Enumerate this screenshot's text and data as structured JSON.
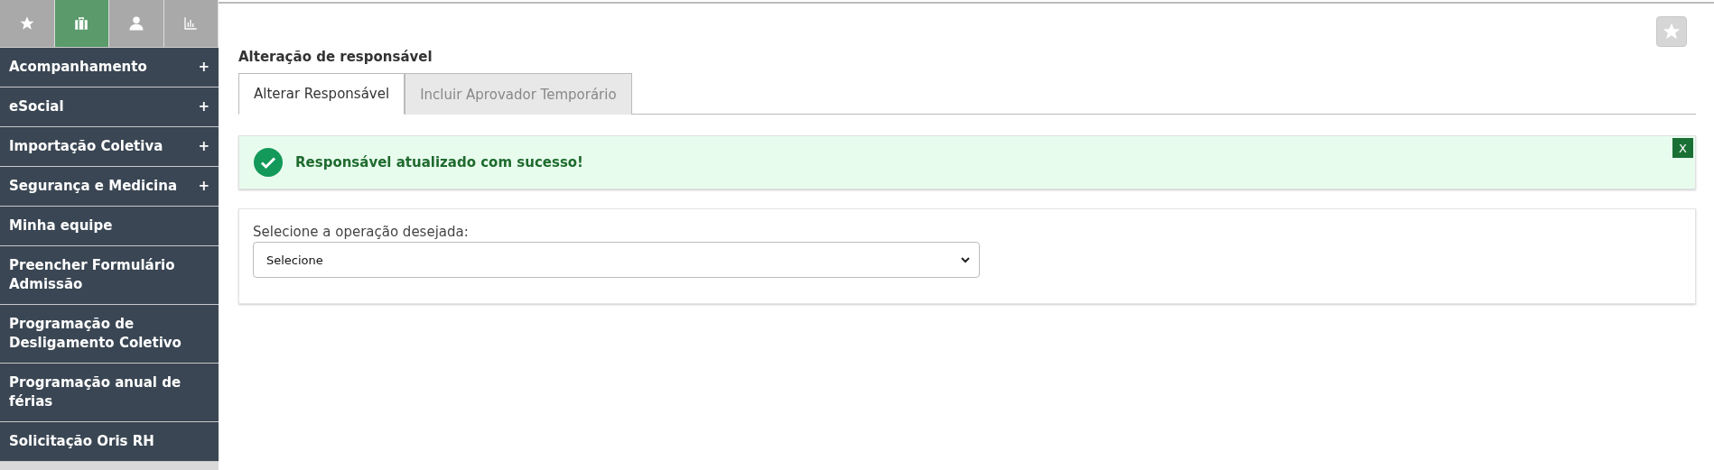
{
  "sidebar": {
    "icon_tabs": [
      {
        "kind": "star",
        "selected": false
      },
      {
        "kind": "briefcase",
        "selected": true
      },
      {
        "kind": "person",
        "selected": false
      },
      {
        "kind": "chart",
        "selected": false
      }
    ],
    "items": [
      {
        "label": "Acompanhamento",
        "expander": "+"
      },
      {
        "label": "eSocial",
        "expander": "+"
      },
      {
        "label": "Importação Coletiva",
        "expander": "+"
      },
      {
        "label": "Segurança e Medicina",
        "expander": "+"
      },
      {
        "label": "Minha equipe"
      },
      {
        "label": "Preencher Formulário Admissão"
      },
      {
        "label": "Programação de Desligamento Coletivo"
      },
      {
        "label": "Programação anual de férias"
      },
      {
        "label": "Solicitação Oris RH"
      }
    ]
  },
  "page": {
    "title": "Alteração de responsável",
    "tabs": [
      {
        "label": "Alterar Responsável",
        "selected": true
      },
      {
        "label": "Incluir Aprovador Temporário",
        "selected": false
      }
    ],
    "alert": {
      "message": "Responsável atualizado com sucesso!",
      "close": "X"
    },
    "form": {
      "label": "Selecione a operação desejada:",
      "select_value": "Selecione"
    }
  }
}
